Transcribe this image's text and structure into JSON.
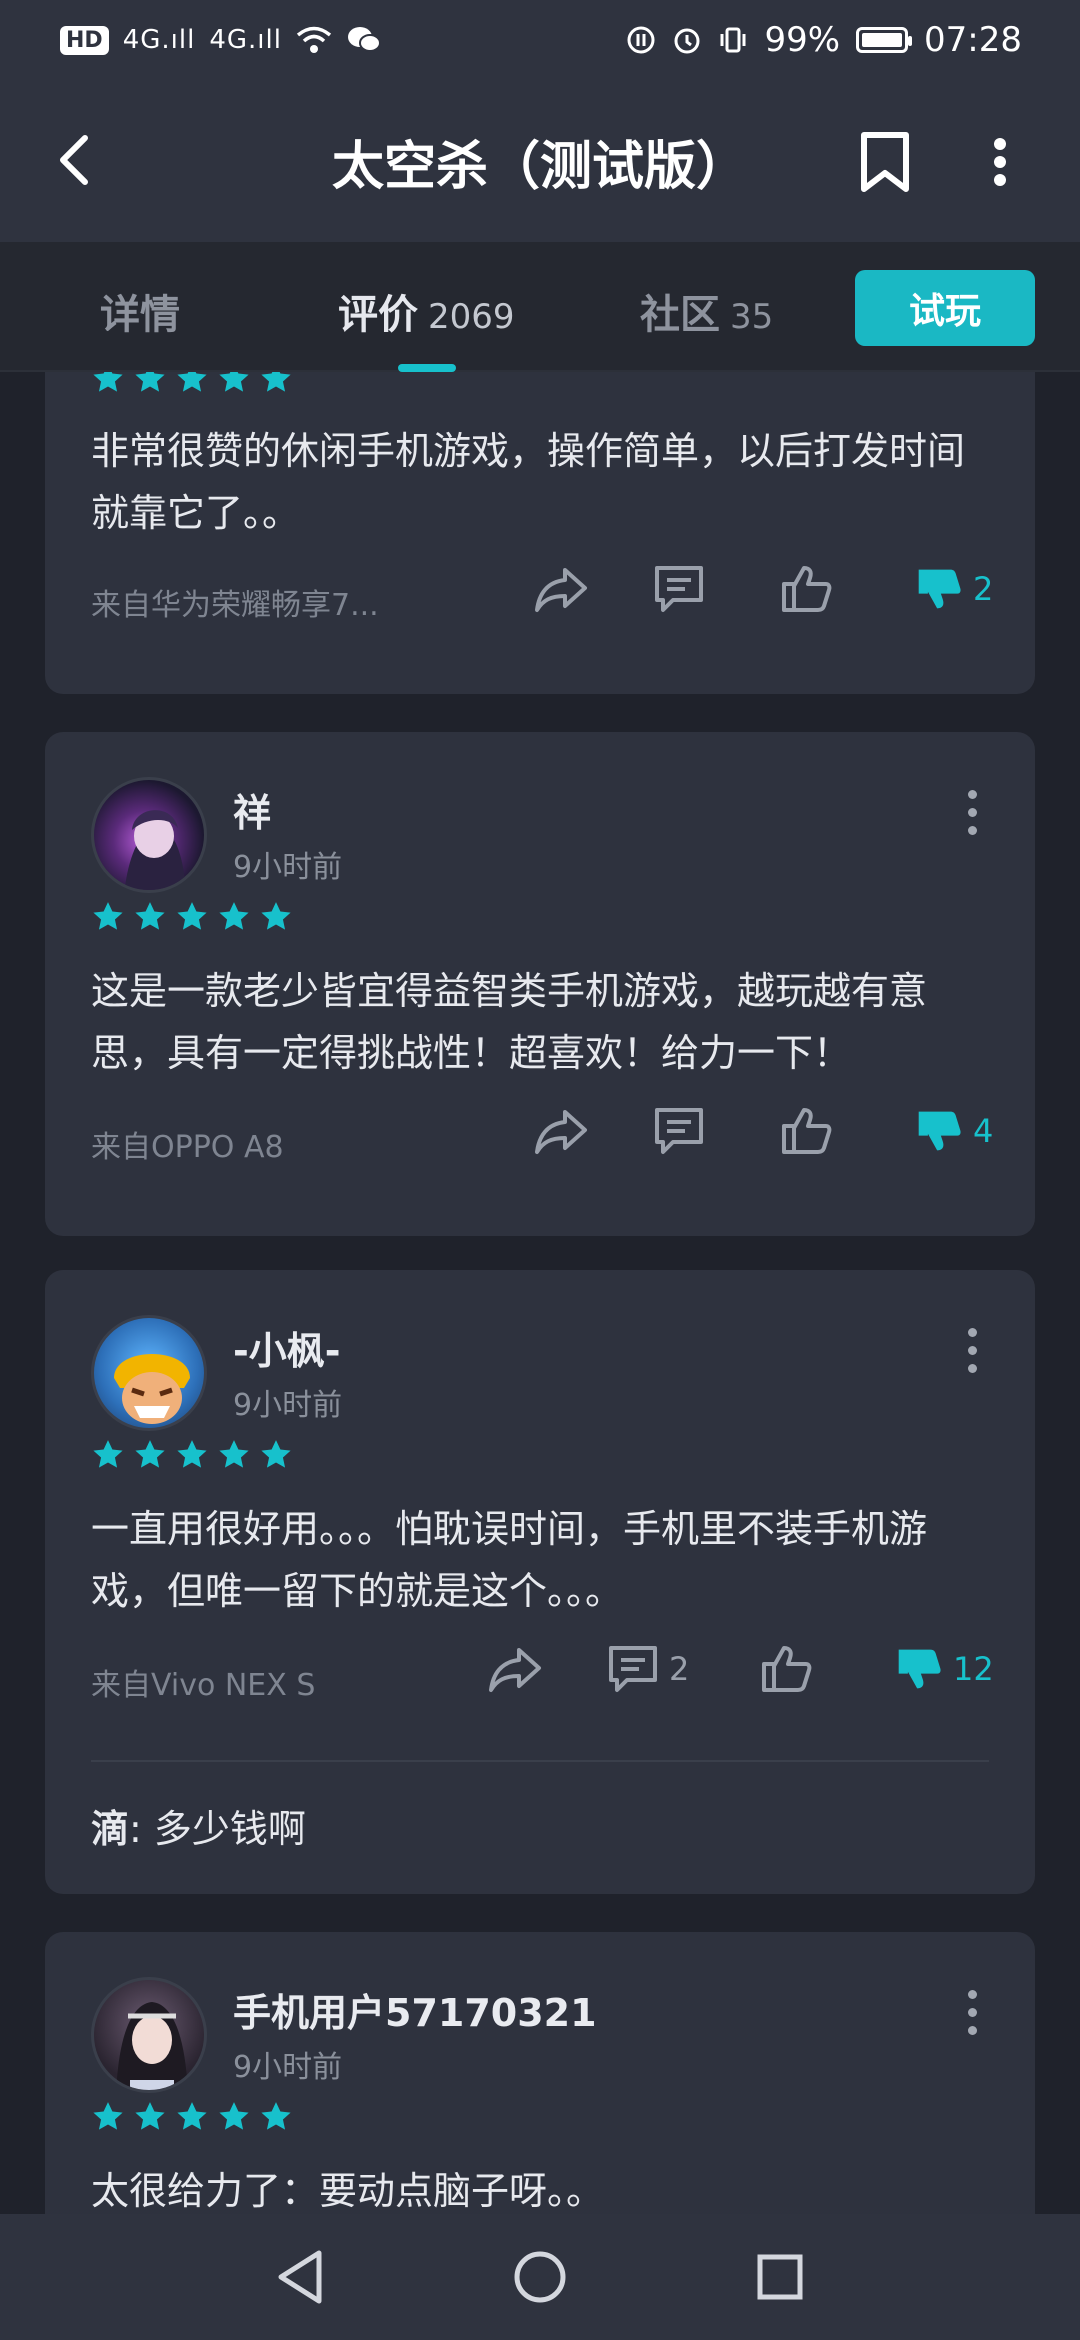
{
  "status_bar": {
    "hd": "HD",
    "signal1": "4G.ıll",
    "signal2": "4G.ıll",
    "battery_percent": "99%",
    "battery_level": 0.99,
    "time": "07:28"
  },
  "header": {
    "title": "太空杀（测试版）"
  },
  "tabs": [
    {
      "label": "详情",
      "count": ""
    },
    {
      "label": "评价",
      "count": "2069"
    },
    {
      "label": "社区",
      "count": "35"
    }
  ],
  "trial_button": "试玩",
  "reviews": [
    {
      "text": "非常很赞的休闲手机游戏，操作简单，以后打发时间就靠它了。。",
      "device": "来自华为荣耀畅享7...",
      "comment_count": "",
      "dislike_count": "2",
      "rating": 5
    },
    {
      "name": "祥",
      "time": "9小时前",
      "text": "这是一款老少皆宜得益智类手机游戏，越玩越有意思，具有一定得挑战性！超喜欢！给力一下！",
      "device": "来自OPPO A8",
      "comment_count": "",
      "dislike_count": "4",
      "rating": 5
    },
    {
      "name": "-小枫-",
      "time": "9小时前",
      "text": "一直用很好用。。。怕耽误时间，手机里不装手机游戏，但唯一留下的就是这个。。。",
      "device": "来自Vivo NEX S",
      "comment_count": "2",
      "dislike_count": "12",
      "rating": 5,
      "reply_author": "滴",
      "reply_text": ": 多少钱啊"
    },
    {
      "name": "手机用户57170321",
      "time": "9小时前",
      "text": "太很给力了：要动点脑子呀。。",
      "rating": 5
    }
  ],
  "colors": {
    "accent": "#17c1cc",
    "card": "#2e323e",
    "background": "#1f222b"
  }
}
